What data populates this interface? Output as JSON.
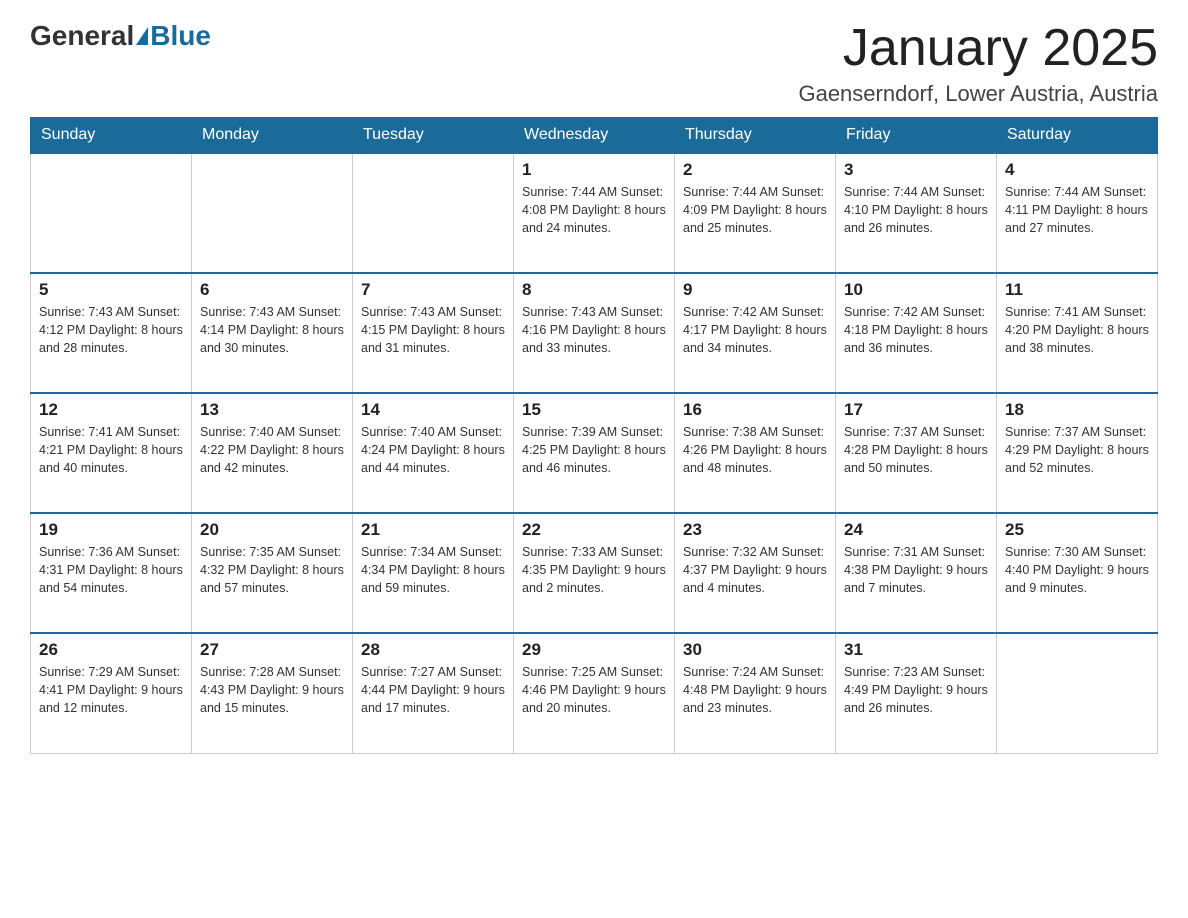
{
  "header": {
    "logo_general": "General",
    "logo_blue": "Blue",
    "title": "January 2025",
    "location": "Gaenserndorf, Lower Austria, Austria"
  },
  "days_of_week": [
    "Sunday",
    "Monday",
    "Tuesday",
    "Wednesday",
    "Thursday",
    "Friday",
    "Saturday"
  ],
  "weeks": [
    [
      {
        "day": "",
        "info": ""
      },
      {
        "day": "",
        "info": ""
      },
      {
        "day": "",
        "info": ""
      },
      {
        "day": "1",
        "info": "Sunrise: 7:44 AM\nSunset: 4:08 PM\nDaylight: 8 hours\nand 24 minutes."
      },
      {
        "day": "2",
        "info": "Sunrise: 7:44 AM\nSunset: 4:09 PM\nDaylight: 8 hours\nand 25 minutes."
      },
      {
        "day": "3",
        "info": "Sunrise: 7:44 AM\nSunset: 4:10 PM\nDaylight: 8 hours\nand 26 minutes."
      },
      {
        "day": "4",
        "info": "Sunrise: 7:44 AM\nSunset: 4:11 PM\nDaylight: 8 hours\nand 27 minutes."
      }
    ],
    [
      {
        "day": "5",
        "info": "Sunrise: 7:43 AM\nSunset: 4:12 PM\nDaylight: 8 hours\nand 28 minutes."
      },
      {
        "day": "6",
        "info": "Sunrise: 7:43 AM\nSunset: 4:14 PM\nDaylight: 8 hours\nand 30 minutes."
      },
      {
        "day": "7",
        "info": "Sunrise: 7:43 AM\nSunset: 4:15 PM\nDaylight: 8 hours\nand 31 minutes."
      },
      {
        "day": "8",
        "info": "Sunrise: 7:43 AM\nSunset: 4:16 PM\nDaylight: 8 hours\nand 33 minutes."
      },
      {
        "day": "9",
        "info": "Sunrise: 7:42 AM\nSunset: 4:17 PM\nDaylight: 8 hours\nand 34 minutes."
      },
      {
        "day": "10",
        "info": "Sunrise: 7:42 AM\nSunset: 4:18 PM\nDaylight: 8 hours\nand 36 minutes."
      },
      {
        "day": "11",
        "info": "Sunrise: 7:41 AM\nSunset: 4:20 PM\nDaylight: 8 hours\nand 38 minutes."
      }
    ],
    [
      {
        "day": "12",
        "info": "Sunrise: 7:41 AM\nSunset: 4:21 PM\nDaylight: 8 hours\nand 40 minutes."
      },
      {
        "day": "13",
        "info": "Sunrise: 7:40 AM\nSunset: 4:22 PM\nDaylight: 8 hours\nand 42 minutes."
      },
      {
        "day": "14",
        "info": "Sunrise: 7:40 AM\nSunset: 4:24 PM\nDaylight: 8 hours\nand 44 minutes."
      },
      {
        "day": "15",
        "info": "Sunrise: 7:39 AM\nSunset: 4:25 PM\nDaylight: 8 hours\nand 46 minutes."
      },
      {
        "day": "16",
        "info": "Sunrise: 7:38 AM\nSunset: 4:26 PM\nDaylight: 8 hours\nand 48 minutes."
      },
      {
        "day": "17",
        "info": "Sunrise: 7:37 AM\nSunset: 4:28 PM\nDaylight: 8 hours\nand 50 minutes."
      },
      {
        "day": "18",
        "info": "Sunrise: 7:37 AM\nSunset: 4:29 PM\nDaylight: 8 hours\nand 52 minutes."
      }
    ],
    [
      {
        "day": "19",
        "info": "Sunrise: 7:36 AM\nSunset: 4:31 PM\nDaylight: 8 hours\nand 54 minutes."
      },
      {
        "day": "20",
        "info": "Sunrise: 7:35 AM\nSunset: 4:32 PM\nDaylight: 8 hours\nand 57 minutes."
      },
      {
        "day": "21",
        "info": "Sunrise: 7:34 AM\nSunset: 4:34 PM\nDaylight: 8 hours\nand 59 minutes."
      },
      {
        "day": "22",
        "info": "Sunrise: 7:33 AM\nSunset: 4:35 PM\nDaylight: 9 hours\nand 2 minutes."
      },
      {
        "day": "23",
        "info": "Sunrise: 7:32 AM\nSunset: 4:37 PM\nDaylight: 9 hours\nand 4 minutes."
      },
      {
        "day": "24",
        "info": "Sunrise: 7:31 AM\nSunset: 4:38 PM\nDaylight: 9 hours\nand 7 minutes."
      },
      {
        "day": "25",
        "info": "Sunrise: 7:30 AM\nSunset: 4:40 PM\nDaylight: 9 hours\nand 9 minutes."
      }
    ],
    [
      {
        "day": "26",
        "info": "Sunrise: 7:29 AM\nSunset: 4:41 PM\nDaylight: 9 hours\nand 12 minutes."
      },
      {
        "day": "27",
        "info": "Sunrise: 7:28 AM\nSunset: 4:43 PM\nDaylight: 9 hours\nand 15 minutes."
      },
      {
        "day": "28",
        "info": "Sunrise: 7:27 AM\nSunset: 4:44 PM\nDaylight: 9 hours\nand 17 minutes."
      },
      {
        "day": "29",
        "info": "Sunrise: 7:25 AM\nSunset: 4:46 PM\nDaylight: 9 hours\nand 20 minutes."
      },
      {
        "day": "30",
        "info": "Sunrise: 7:24 AM\nSunset: 4:48 PM\nDaylight: 9 hours\nand 23 minutes."
      },
      {
        "day": "31",
        "info": "Sunrise: 7:23 AM\nSunset: 4:49 PM\nDaylight: 9 hours\nand 26 minutes."
      },
      {
        "day": "",
        "info": ""
      }
    ]
  ]
}
